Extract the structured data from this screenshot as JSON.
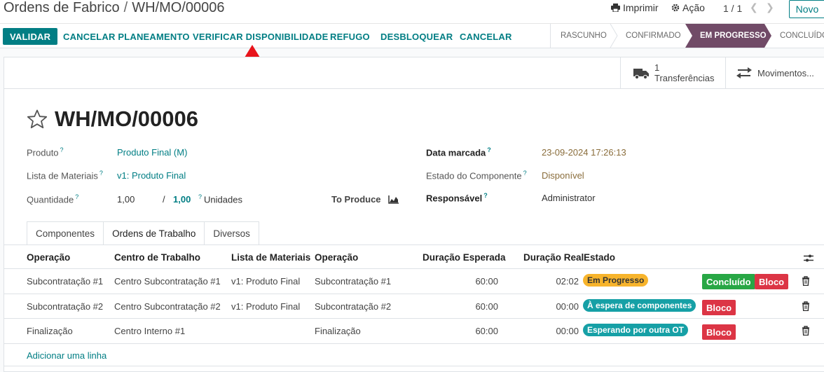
{
  "breadcrumb": {
    "parent": "Ordens de Fabrico",
    "separator": "/",
    "current": "WH/MO/00006"
  },
  "topbar": {
    "print_label": "Imprimir",
    "action_label": "Ação",
    "pager": "1 / 1",
    "new_label": "Novo"
  },
  "statusbar": {
    "buttons": [
      "VALIDAR",
      "CANCELAR PLANEAMENTO",
      "VERIFICAR DISPONIBILIDADE",
      "REFUGO",
      "DESBLOQUEAR",
      "CANCELAR"
    ],
    "stages": [
      "RASCUNHO",
      "CONFIRMADO",
      "EM PROGRESSO",
      "CONCLUÍDO"
    ],
    "active_stage": "EM PROGRESSO"
  },
  "smart_buttons": [
    {
      "count": "1",
      "label": "Transferências",
      "icon": "truck-icon"
    },
    {
      "label": "Movimentos...",
      "icon": "exchange-icon"
    }
  ],
  "record": {
    "title": "WH/MO/00006",
    "fields": {
      "product_label": "Produto",
      "product": "Produto Final (M)",
      "bom_label": "Lista de Materiais",
      "bom": "v1: Produto Final",
      "qty_label": "Quantidade",
      "qty_produced": "1,00",
      "qty_sep": "/",
      "qty_total": "1,00",
      "uom": "Unidades",
      "to_produce_label": "To Produce",
      "date_label": "Data marcada",
      "date": "23-09-2024 17:26:13",
      "component_state_label": "Estado do Componente",
      "component_state": "Disponível",
      "responsible_label": "Responsável",
      "responsible": "Administrator",
      "help_marker": "?"
    }
  },
  "tabs": [
    "Componentes",
    "Ordens de Trabalho",
    "Diversos"
  ],
  "active_tab": "Ordens de Trabalho",
  "table": {
    "headers": [
      "Operação",
      "Centro de Trabalho",
      "Lista de Materiais",
      "Operação",
      "Duração Esperada",
      "Duração Real",
      "Estado"
    ],
    "rows": [
      {
        "operation": "Subcontratação #1",
        "workcenter": "Centro Subcontratação #1",
        "bom": "v1: Produto Final",
        "operation2": "Subcontratação #1",
        "expected": "60:00",
        "real": "02:02",
        "state": "Em Progresso",
        "state_color": "#f7b42c",
        "actions": [
          "Concluído",
          "Bloco"
        ]
      },
      {
        "operation": "Subcontratação #2",
        "workcenter": "Centro Subcontratação #2",
        "bom": "v1: Produto Final",
        "operation2": "Subcontratação #2",
        "expected": "60:00",
        "real": "00:00",
        "state": "À espera de componentes",
        "state_color": "#16a0a6",
        "actions": [
          "Bloco"
        ]
      },
      {
        "operation": "Finalização",
        "workcenter": "Centro Interno #1",
        "bom": "",
        "operation2": "Finalização",
        "expected": "60:00",
        "real": "00:00",
        "state": "Esperando por outra OT",
        "state_color": "#16a0a6",
        "actions": [
          "Bloco"
        ]
      }
    ],
    "add_line": "Adicionar uma linha"
  },
  "colors": {
    "accent": "#017e84",
    "active_stage": "#714b67",
    "done_green": "#28a745",
    "block_red": "#dc3545",
    "annotation_arrow": "#e8141b"
  }
}
